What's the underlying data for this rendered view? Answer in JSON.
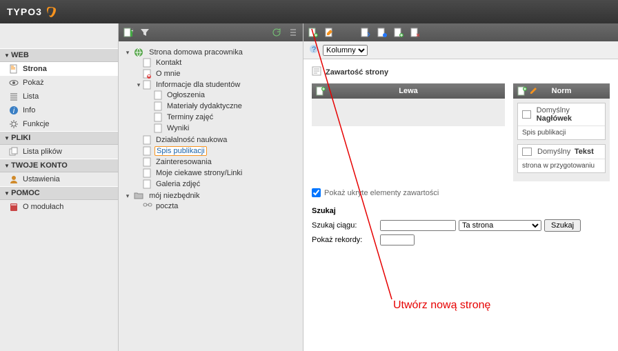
{
  "app": {
    "name": "TYPO3"
  },
  "nav": {
    "sections": {
      "web": {
        "title": "WEB",
        "items": [
          {
            "label": "Strona",
            "icon_color": "#f7931e",
            "active": true
          },
          {
            "label": "Pokaż",
            "icon_color": "#555"
          },
          {
            "label": "Lista",
            "icon_color": "#555"
          },
          {
            "label": "Info",
            "icon_color": "#2a6fb3"
          },
          {
            "label": "Funkcje",
            "icon_color": "#555"
          }
        ]
      },
      "pliki": {
        "title": "PLIKI",
        "items": [
          {
            "label": "Lista plików",
            "icon_color": "#888"
          }
        ]
      },
      "konto": {
        "title": "TWOJE KONTO",
        "items": [
          {
            "label": "Ustawienia",
            "icon_color": "#d08a2a"
          }
        ]
      },
      "pomoc": {
        "title": "POMOC",
        "items": [
          {
            "label": "O modułach",
            "icon_color": "#c33"
          }
        ]
      }
    }
  },
  "tree": {
    "root": {
      "label": "Strona domowa pracownika",
      "icon": "globe"
    },
    "children": [
      {
        "label": "Kontakt"
      },
      {
        "label": "O mnie",
        "locked": true
      },
      {
        "label": "Informacje dla studentów",
        "expanded": true,
        "children": [
          {
            "label": "Ogłoszenia"
          },
          {
            "label": "Materiały dydaktyczne"
          },
          {
            "label": "Terminy zajęć"
          },
          {
            "label": "Wyniki"
          }
        ]
      },
      {
        "label": "Działalność naukowa"
      },
      {
        "label": "Spis publikacji",
        "selected": true
      },
      {
        "label": "Zainteresowania"
      },
      {
        "label": "Moje ciekawe strony/Linki"
      },
      {
        "label": "Galeria zdjęć"
      }
    ],
    "second": {
      "label": "mój niezbędnik",
      "icon": "folder",
      "expanded": true,
      "children": [
        {
          "label": "poczta",
          "icon": "link"
        }
      ]
    }
  },
  "main": {
    "view_selector": {
      "options": [
        "Kolumny"
      ],
      "selected": "Kolumny"
    },
    "content_title": "Zawartość strony",
    "panels": {
      "left": {
        "title": "Lewa"
      },
      "right": {
        "title": "Norm",
        "cards": [
          {
            "type_label": "Domyślny",
            "subtype": "Nagłówek",
            "body": "Spis publikacji"
          },
          {
            "type_label": "Domyślny",
            "subtype": "Tekst",
            "body": "strona w przygotowaniu"
          }
        ]
      }
    },
    "hidden_label": "Pokaż ukryte elementy zawartości",
    "search": {
      "title": "Szukaj",
      "row1_label": "Szukaj ciągu:",
      "scope_options": [
        "Ta strona"
      ],
      "scope_selected": "Ta strona",
      "button": "Szukaj",
      "row2_label": "Pokaż rekordy:"
    }
  },
  "annotation": {
    "text": "Utwórz nową stronę"
  },
  "colors": {
    "accent": "#f7931e",
    "link": "#1a62a8",
    "red": "#e60000"
  }
}
